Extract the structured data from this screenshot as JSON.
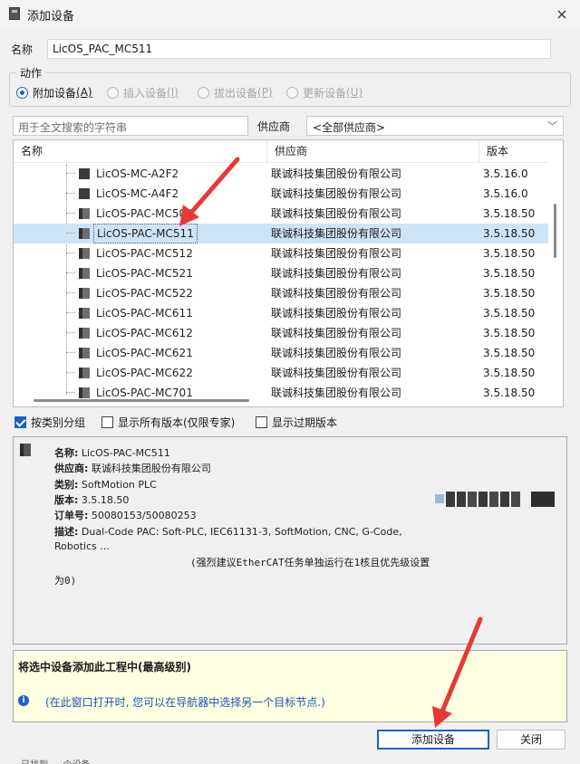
{
  "window": {
    "title": "添加设备",
    "close_icon": "×"
  },
  "name_field": {
    "label": "名称",
    "value": "LicOS_PAC_MC511"
  },
  "action": {
    "title": "动作",
    "options": [
      {
        "label": "附加设备",
        "key": "(A)",
        "selected": true,
        "enabled": true
      },
      {
        "label": "插入设备",
        "key": "(I)",
        "selected": false,
        "enabled": false
      },
      {
        "label": "拔出设备",
        "key": "(P)",
        "selected": false,
        "enabled": false
      },
      {
        "label": "更新设备",
        "key": "(U)",
        "selected": false,
        "enabled": false
      }
    ]
  },
  "search": {
    "placeholder": "用于全文搜索的字符串"
  },
  "vendor": {
    "label": "供应商",
    "selected": "<全部供应商>",
    "arrow_icon": "﹀"
  },
  "list": {
    "columns": [
      "名称",
      "供应商",
      "版本"
    ],
    "rows": [
      {
        "name": "LicOS-MC-A2F2",
        "vendor": "联诚科技集团股份有限公司",
        "version": "3.5.16.0",
        "icon": "device-icon"
      },
      {
        "name": "LicOS-MC-A4F2",
        "vendor": "联诚科技集团股份有限公司",
        "version": "3.5.16.0",
        "icon": "device-icon"
      },
      {
        "name": "LicOS-PAC-MC501",
        "vendor": "联诚科技集团股份有限公司",
        "version": "3.5.18.50",
        "icon": "pac-device-icon"
      },
      {
        "name": "LicOS-PAC-MC511",
        "vendor": "联诚科技集团股份有限公司",
        "version": "3.5.18.50",
        "icon": "pac-device-icon",
        "selected": true
      },
      {
        "name": "LicOS-PAC-MC512",
        "vendor": "联诚科技集团股份有限公司",
        "version": "3.5.18.50",
        "icon": "pac-device-icon"
      },
      {
        "name": "LicOS-PAC-MC521",
        "vendor": "联诚科技集团股份有限公司",
        "version": "3.5.18.50",
        "icon": "pac-device-icon"
      },
      {
        "name": "LicOS-PAC-MC522",
        "vendor": "联诚科技集团股份有限公司",
        "version": "3.5.18.50",
        "icon": "pac-device-icon"
      },
      {
        "name": "LicOS-PAC-MC611",
        "vendor": "联诚科技集团股份有限公司",
        "version": "3.5.18.50",
        "icon": "pac-device-icon"
      },
      {
        "name": "LicOS-PAC-MC612",
        "vendor": "联诚科技集团股份有限公司",
        "version": "3.5.18.50",
        "icon": "pac-device-icon"
      },
      {
        "name": "LicOS-PAC-MC621",
        "vendor": "联诚科技集团股份有限公司",
        "version": "3.5.18.50",
        "icon": "pac-device-icon"
      },
      {
        "name": "LicOS-PAC-MC622",
        "vendor": "联诚科技集团股份有限公司",
        "version": "3.5.18.50",
        "icon": "pac-device-icon"
      },
      {
        "name": "LicOS-PAC-MC701",
        "vendor": "联诚科技集团股份有限公司",
        "version": "3.5.18.50",
        "icon": "pac-device-icon"
      }
    ]
  },
  "options": {
    "group_by_category": {
      "label": "按类别分组",
      "checked": true
    },
    "show_all_versions": {
      "label": "显示所有版本(仅限专家)",
      "checked": false
    },
    "show_outdated": {
      "label": "显示过期版本",
      "checked": false
    }
  },
  "info": {
    "name_label": "名称:",
    "name": "LicOS-PAC-MC511",
    "vendor_label": "供应商:",
    "vendor": "联诚科技集团股份有限公司",
    "category_label": "类别:",
    "category": "SoftMotion PLC",
    "version_label": "版本:",
    "version": "3.5.18.50",
    "order_label": "订单号:",
    "order": "50080153/50080253",
    "desc_label": "描述:",
    "desc_line1": "Dual-Code PAC: Soft-PLC, IEC61131-3, SoftMotion, CNC, G-Code,",
    "desc_line2": "Robotics ...",
    "note": "(强烈建议EtherCAT任务单独运行在1核且优先级设置为0)"
  },
  "hint": {
    "title": "将选中设备添加此工程中(最高级别)",
    "icon": "i",
    "text": "(在此窗口打开时, 您可以在导航器中选择另一个目标节点.)"
  },
  "buttons": {
    "add": "添加设备",
    "close": "关闭"
  },
  "status_bar": {
    "text": "… 已找到 … 个设备 …"
  },
  "colors": {
    "accent": "#1a63c6",
    "selection": "#cce4f7",
    "hint_bg": "#ffffe1",
    "arrow": "#e53935"
  }
}
